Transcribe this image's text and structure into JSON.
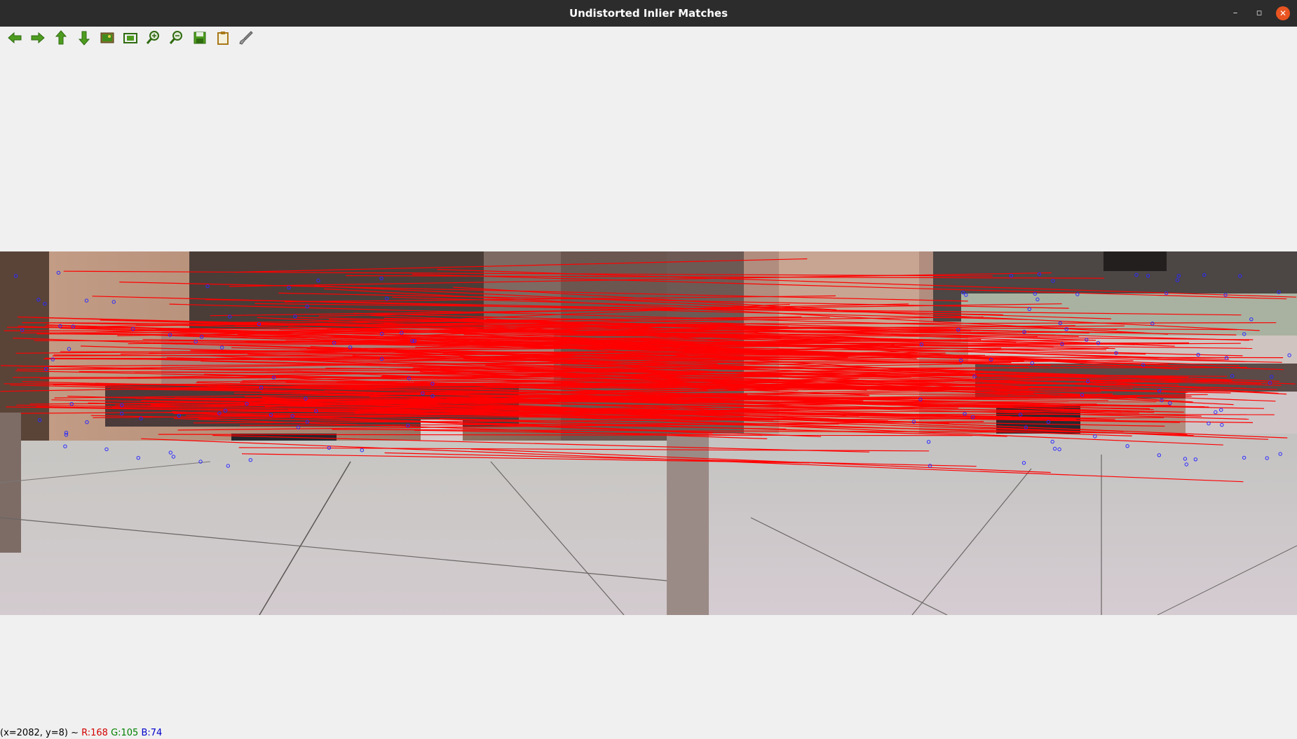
{
  "window": {
    "title": "Undistorted Inlier Matches",
    "buttons": {
      "minimize": "–",
      "maximize": "▫",
      "close": "✕"
    }
  },
  "toolbar": {
    "items": [
      {
        "name": "pan-left-button",
        "icon": "arrow-left-icon"
      },
      {
        "name": "pan-right-button",
        "icon": "arrow-right-icon"
      },
      {
        "name": "pan-up-button",
        "icon": "arrow-up-icon"
      },
      {
        "name": "pan-down-button",
        "icon": "arrow-down-icon"
      },
      {
        "name": "zoom-original-button",
        "icon": "image-icon"
      },
      {
        "name": "zoom-fit-button",
        "icon": "fit-window-icon"
      },
      {
        "name": "zoom-in-button",
        "icon": "zoom-in-icon"
      },
      {
        "name": "zoom-out-button",
        "icon": "zoom-out-icon"
      },
      {
        "name": "save-button",
        "icon": "save-icon"
      },
      {
        "name": "copy-button",
        "icon": "clipboard-icon"
      },
      {
        "name": "properties-button",
        "icon": "brush-icon"
      }
    ],
    "icon_color": "#3a8c14"
  },
  "status": {
    "coords": "(x=2082, y=8) ~ ",
    "r": "R:168",
    "g": "G:105",
    "b": "B:74"
  },
  "colors": {
    "match_line": "#ff0000",
    "keypoint": "#2a2aff",
    "close_button": "#e95420"
  }
}
